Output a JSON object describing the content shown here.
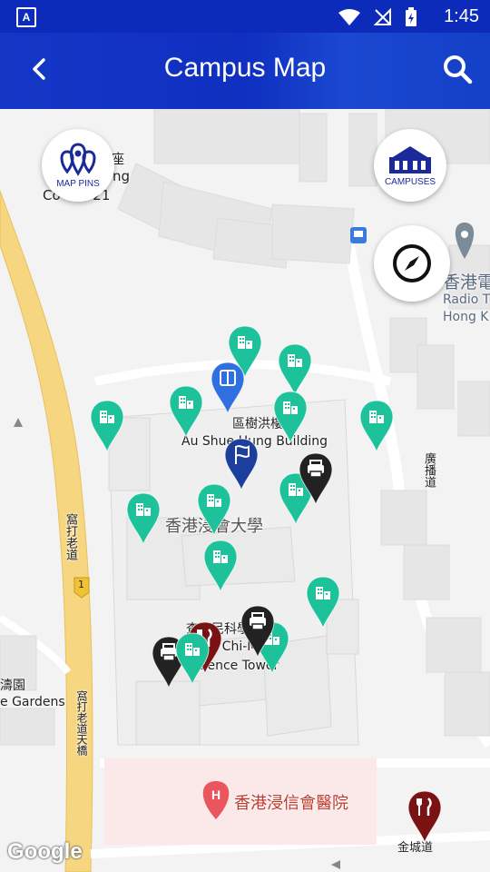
{
  "status_bar": {
    "time": "1:45",
    "left_badge": "A"
  },
  "app_bar": {
    "title": "Campus Map"
  },
  "fabs": {
    "map_pins": "MAP PINS",
    "campuses": "CAMPUSES"
  },
  "map_labels": {
    "top_left_1": "座",
    "top_left_2": "ng",
    "top_left_3": "Co     ock 21",
    "radio_1": "香港電",
    "radio_2": "Radio T",
    "radio_3": "Hong K",
    "au_zh": "區樹洪樓",
    "au_en": "Au Shue Hung Building",
    "hkbu_zh": "香港浸會大學",
    "road_left": "窩打老道",
    "road_num": "1",
    "right_road": "廣播道",
    "chachi_zh": "查濟民科學大樓",
    "chachi_en1": "Cha Chi-Ming",
    "chachi_en2": "Science Tower",
    "gardens_zh": "濤園",
    "gardens_en": "e Gardens",
    "flyover": "窩打老道天橋",
    "hospital": "香港浸信會醫院",
    "kam_shing": "金城道",
    "google": "Google"
  },
  "pin_colors": {
    "teal": "#1ec29a",
    "black": "#222222",
    "navy": "#1c3e9c",
    "blue": "#2f6fe0",
    "maroon": "#7a1214",
    "gray": "#7d8b99"
  },
  "pins": [
    {
      "type": "building",
      "color": "teal"
    },
    {
      "type": "building",
      "color": "teal"
    },
    {
      "type": "building",
      "color": "teal"
    },
    {
      "type": "building",
      "color": "teal"
    },
    {
      "type": "building",
      "color": "teal"
    },
    {
      "type": "building",
      "color": "teal"
    },
    {
      "type": "building",
      "color": "teal"
    },
    {
      "type": "building",
      "color": "teal"
    },
    {
      "type": "building",
      "color": "teal"
    },
    {
      "type": "building",
      "color": "teal"
    },
    {
      "type": "building",
      "color": "teal"
    },
    {
      "type": "building",
      "color": "teal"
    },
    {
      "type": "library",
      "color": "blue"
    },
    {
      "type": "flag",
      "color": "navy"
    },
    {
      "type": "printer",
      "color": "black"
    },
    {
      "type": "printer",
      "color": "black"
    },
    {
      "type": "printer",
      "color": "black"
    },
    {
      "type": "restaurant",
      "color": "maroon"
    },
    {
      "type": "restaurant",
      "color": "maroon"
    },
    {
      "type": "building",
      "color": "teal"
    }
  ]
}
